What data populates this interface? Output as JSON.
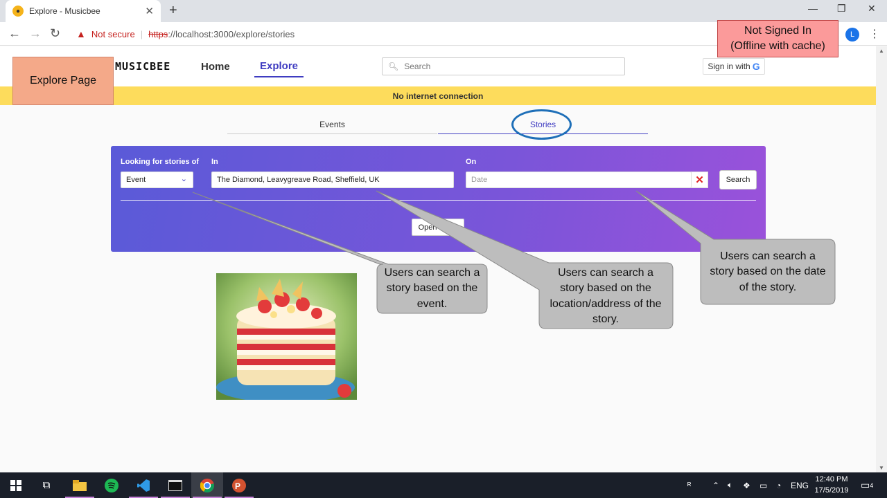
{
  "browser": {
    "tab_title": "Explore - Musicbee",
    "new_tab": "+",
    "not_secure": "Not secure",
    "url_scheme": "https",
    "url_rest": "://localhost:3000/explore/stories",
    "profile_initial": "L"
  },
  "app": {
    "logo": "MUSICBEE",
    "nav": {
      "home": "Home",
      "explore": "Explore"
    },
    "search_placeholder": "Search",
    "signin_label": "Sign in with",
    "signin_g": "G",
    "offline_banner": "No internet connection"
  },
  "subtabs": {
    "events": "Events",
    "stories": "Stories"
  },
  "search_panel": {
    "looking_label": "Looking for stories of",
    "type_value": "Event",
    "in_label": "In",
    "location_value": "The Diamond, Leavygreave Road, Sheffield, UK",
    "on_label": "On",
    "date_placeholder": "Date",
    "clear_glyph": "✕",
    "search_button": "Search",
    "open_button": "Open Maps"
  },
  "annotations": {
    "explore_page": "Explore Page",
    "not_signed_in_line1": "Not Signed In",
    "not_signed_in_line2": "(Offline with cache)",
    "callout_event": "Users can search a story based on the event.",
    "callout_location": "Users can search a story based on the location/address of the story.",
    "callout_date": "Users can search a story based on the date of the story."
  },
  "taskbar": {
    "language": "ENG",
    "time": "12:40 PM",
    "date": "17/5/2019",
    "notification_count": "4"
  },
  "colors": {
    "accent": "#3f3cc1",
    "offline_banner": "#fddc5c",
    "annotation_orange": "#f4a989",
    "annotation_red": "#fb9a9a",
    "callout_gray": "#bdbdbd"
  }
}
